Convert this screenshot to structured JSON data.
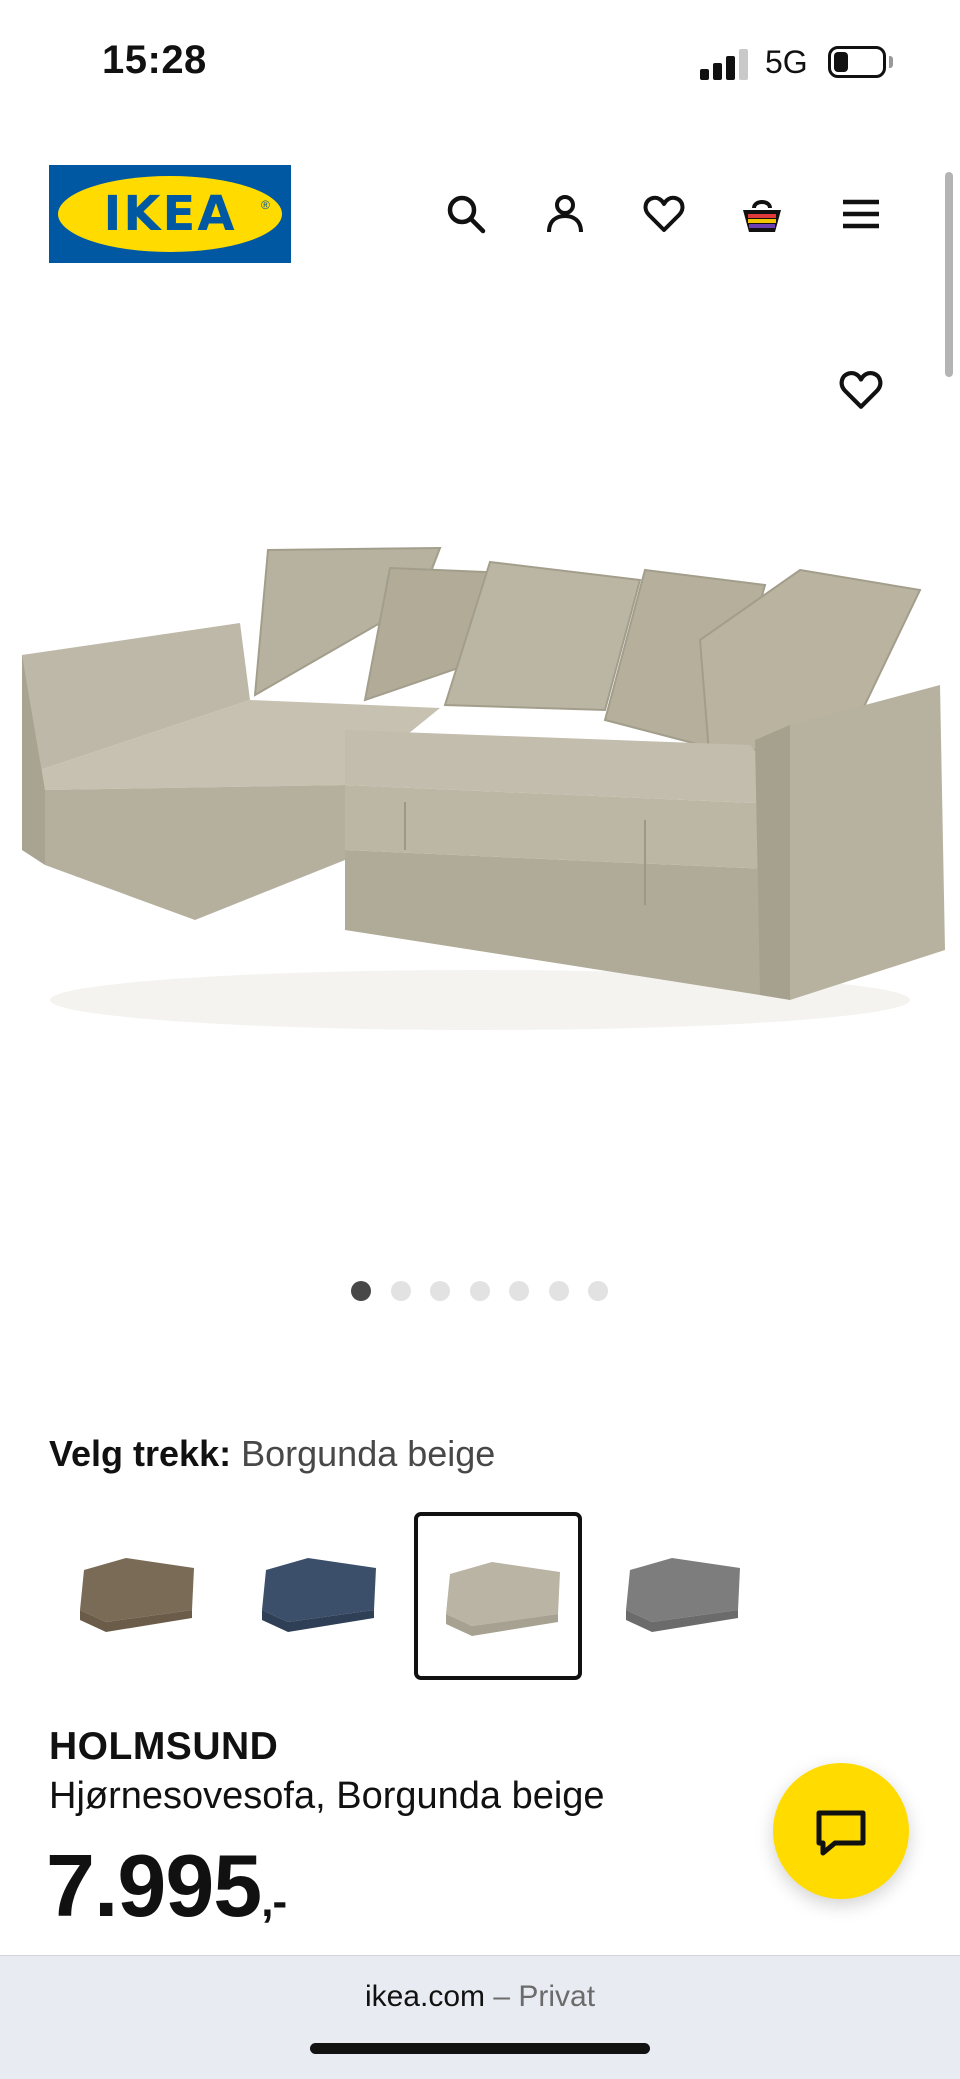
{
  "status_bar": {
    "time": "15:28",
    "network": "5G"
  },
  "header": {
    "logo_text": "IKEA",
    "logo_reg": "®",
    "colors": {
      "brand_blue": "#0058a3",
      "brand_yellow": "#ffdb00"
    },
    "icons": [
      "search-icon",
      "account-icon",
      "heart-icon",
      "shopping-bag-icon",
      "menu-icon"
    ]
  },
  "gallery": {
    "image_count": 7,
    "active_index": 0
  },
  "cover": {
    "label": "Velg trekk:",
    "value": "Borgunda beige",
    "options": [
      {
        "color": "#7a6b57"
      },
      {
        "color": "#3b4f6b"
      },
      {
        "color": "#b9b4a3",
        "selected": true
      },
      {
        "color": "#7d7d7d"
      }
    ]
  },
  "product": {
    "name": "HOLMSUND",
    "description": "Hjørnesovesofa, Borgunda beige",
    "price": "7.995",
    "price_suffix": ",-"
  },
  "browser": {
    "domain": "ikea.com",
    "separator": " – ",
    "mode": "Privat"
  }
}
